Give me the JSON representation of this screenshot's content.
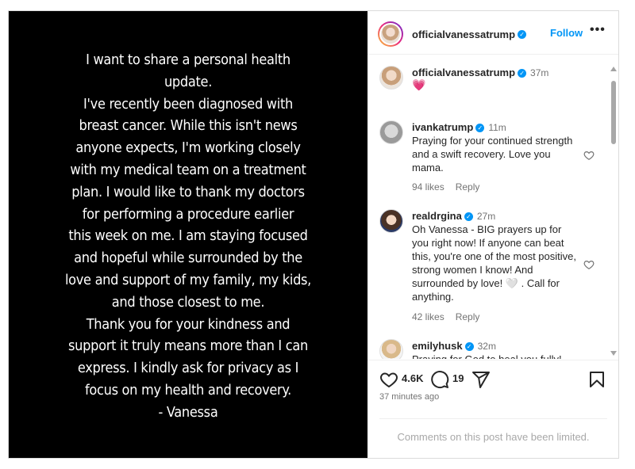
{
  "post": {
    "text_lines": [
      "I want to share a personal health",
      "update.",
      "I've recently been diagnosed with",
      "breast cancer. While this isn't news",
      "anyone expects, I'm working closely",
      "with my medical team on a treatment",
      "plan. I would like to thank my doctors",
      "for performing a procedure earlier",
      "this week on me. I am staying focused",
      "and hopeful while surrounded by the",
      "love and support of my family, my kids,",
      "and those closest to me.",
      "Thank you for your kindness and",
      "support it truly means more than I can",
      "express. I kindly ask for privacy as I",
      "focus on my health and recovery.",
      "- Vanessa"
    ]
  },
  "header": {
    "username": "officialvanessatrump",
    "follow_label": "Follow",
    "more_label": "•••"
  },
  "caption": {
    "username": "officialvanessatrump",
    "time": "37m",
    "emoji": "💗"
  },
  "comments": [
    {
      "username": "ivankatrump",
      "time": "11m",
      "text": "Praying for your continued strength and a swift recovery. Love you mama.",
      "likes": "94 likes",
      "reply": "Reply"
    },
    {
      "username": "realdrgina",
      "time": "27m",
      "text": "Oh Vanessa - BIG prayers up for you right now! If anyone can beat this, you're one of the most positive, strong women I know! And surrounded by love! 🤍 . Call for anything.",
      "likes": "42 likes",
      "reply": "Reply"
    },
    {
      "username": "emilyhusk",
      "time": "32m",
      "text": "Praying for God to heal you fully!"
    }
  ],
  "actions": {
    "likes_count": "4.6K",
    "comments_count": "19",
    "timestamp": "37 minutes ago"
  },
  "footer": {
    "limited_text": "Comments on this post have been limited."
  },
  "colors": {
    "accent": "#0095f6",
    "muted": "#737373",
    "caption_heart": "#e0245e"
  },
  "icons": [
    "heart-icon",
    "comment-icon",
    "share-icon",
    "bookmark-icon",
    "verified-icon",
    "more-icon"
  ]
}
